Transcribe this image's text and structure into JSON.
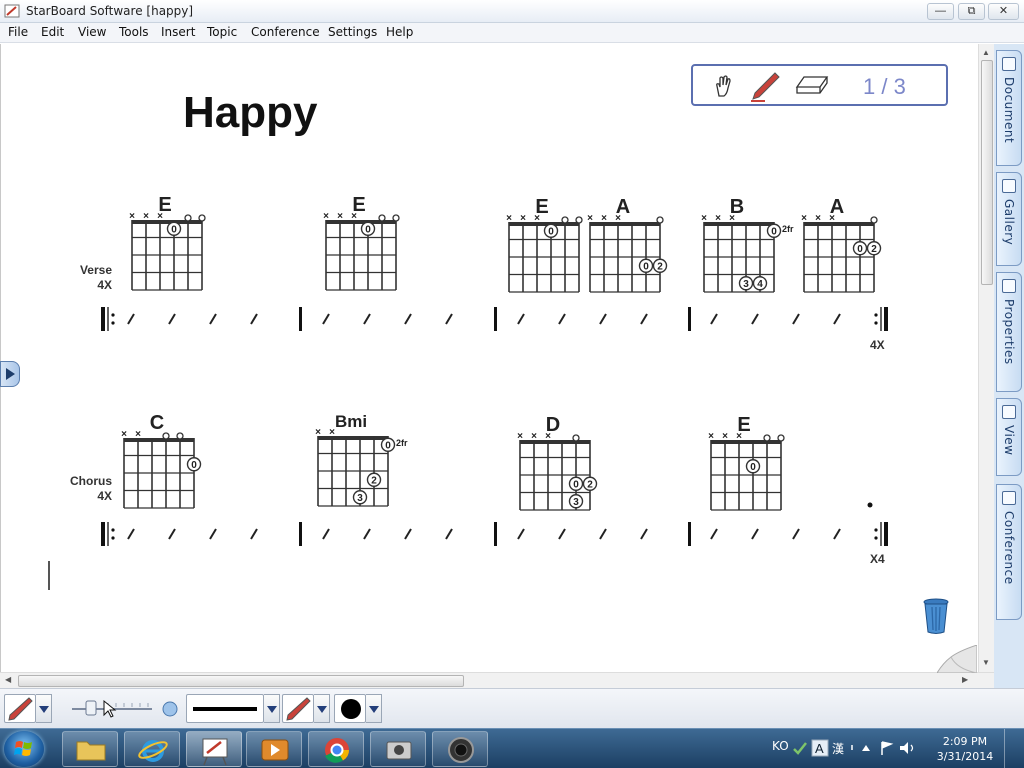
{
  "window": {
    "title": "StarBoard Software [happy]"
  },
  "menu": [
    "File",
    "Edit",
    "View",
    "Tools",
    "Insert",
    "Topic",
    "Conference",
    "Settings",
    "Help"
  ],
  "sidebar_tabs": [
    "Document",
    "Gallery",
    "Properties",
    "View",
    "Conference"
  ],
  "page_nav": {
    "page_indicator": "1 / 3"
  },
  "song": {
    "title": "Happy",
    "verse": {
      "label": "Verse",
      "count": "4X",
      "chords": [
        "E",
        "E",
        "E",
        "A",
        "B",
        "A"
      ],
      "fret_note": "2fr",
      "end_repeat": "4X"
    },
    "chorus": {
      "label": "Chorus",
      "count": "4X",
      "chords": [
        "C",
        "Bmi",
        "D",
        "E"
      ],
      "fret_note": "2fr",
      "end_repeat": "X4"
    }
  },
  "taskbar": {
    "language": "KO",
    "time": "2:09 PM",
    "date": "3/31/2014"
  },
  "icons": {
    "hand_tool": "hand-icon",
    "pen_tool": "pen-icon",
    "eraser_tool": "eraser-icon",
    "trash": "trash-icon"
  },
  "colors": {
    "nav_border": "#5b6fb0",
    "page_number": "#7c87c9",
    "sidepanel": "#d8e6f5",
    "taskbar": "#1c3f63"
  }
}
